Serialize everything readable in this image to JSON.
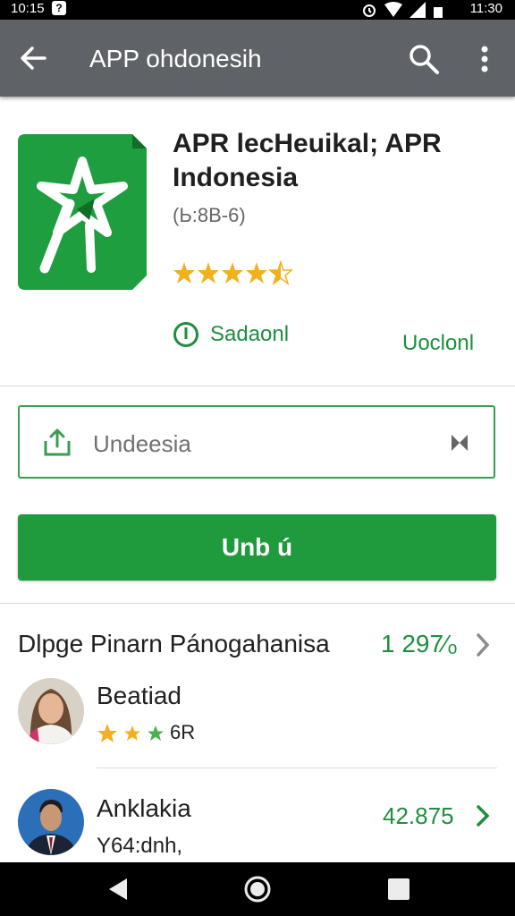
{
  "status_bar": {
    "time_left": "10:15",
    "notif_glyph": "?",
    "time_right": "11:30"
  },
  "app_bar": {
    "title": "APP ohdonesih",
    "icons": [
      "back-arrow-icon",
      "search-icon",
      "more-vert-icon"
    ]
  },
  "app": {
    "title": "APR lecHeuikal; APR Indonesia",
    "subtitle": "(Ь:8B-6)",
    "rating": 4.5,
    "install_label": "Sadaonl",
    "secondary_action": "Uoclonl",
    "icon_color": "#1e9e3e"
  },
  "search": {
    "value": "Undeesia"
  },
  "primary_button": {
    "label": "Unb ú"
  },
  "section": {
    "title": "Dlpge Pinarn Pánogahanisa",
    "count": "1 297⁄ₒ"
  },
  "reviews": [
    {
      "name": "Beаtiad",
      "rating": 3,
      "meta": "6R"
    },
    {
      "name": "Anklakia",
      "meta": "Y64:dnh,",
      "value": "42.875"
    }
  ],
  "colors": {
    "accent": "#1f9a3d",
    "appbar": "#5f6368",
    "text_green": "#1e8e3e"
  }
}
